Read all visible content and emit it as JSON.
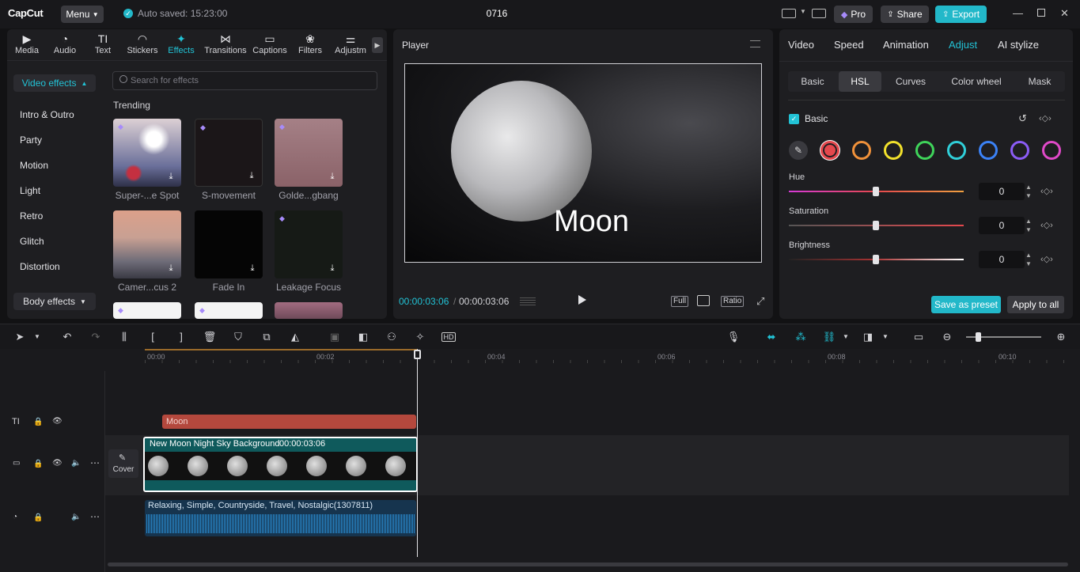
{
  "app": {
    "logo": "CapCut",
    "menu_label": "Menu",
    "autosave": "Auto saved: 15:23:00",
    "project_title": "0716"
  },
  "topbar": {
    "pro_label": "Pro",
    "share_label": "Share",
    "export_label": "Export",
    "accent": "#22c3d6"
  },
  "left_tabs": [
    {
      "label": "Media",
      "icon": "media-icon"
    },
    {
      "label": "Audio",
      "icon": "audio-icon"
    },
    {
      "label": "Text",
      "icon": "text-icon"
    },
    {
      "label": "Stickers",
      "icon": "stickers-icon"
    },
    {
      "label": "Effects",
      "icon": "effects-icon",
      "active": true
    },
    {
      "label": "Transitions",
      "icon": "transitions-icon"
    },
    {
      "label": "Captions",
      "icon": "captions-icon"
    },
    {
      "label": "Filters",
      "icon": "filters-icon"
    },
    {
      "label": "Adjustm",
      "icon": "adjustment-icon"
    }
  ],
  "effects": {
    "video_effects_label": "Video effects",
    "body_effects_label": "Body effects",
    "categories": [
      "Intro & Outro",
      "Party",
      "Motion",
      "Light",
      "Retro",
      "Glitch",
      "Distortion"
    ],
    "search_placeholder": "Search for effects",
    "section_title": "Trending",
    "items": [
      "Super-...e Spot",
      "S-movement",
      "Golde...gbang",
      "Camer...cus 2",
      "Fade In",
      "Leakage Focus"
    ]
  },
  "player": {
    "title": "Player",
    "overlay_text": "Moon",
    "current_time": "00:00:03:06",
    "total_time": "00:00:03:06",
    "full_label": "Full",
    "ratio_label": "Ratio"
  },
  "right_panel": {
    "tabs": [
      "Video",
      "Speed",
      "Animation",
      "Adjust",
      "AI stylize"
    ],
    "active_tab": "Adjust",
    "subtabs": [
      "Basic",
      "HSL",
      "Curves",
      "Color wheel",
      "Mask"
    ],
    "active_subtab": "HSL",
    "basic_label": "Basic",
    "hsl_colors": [
      "#e5484d",
      "#f0913a",
      "#f2e12c",
      "#3fd45a",
      "#30cfd9",
      "#3b82f6",
      "#8b5cf6",
      "#e049c8"
    ],
    "sliders": [
      {
        "label": "Hue",
        "value": "0"
      },
      {
        "label": "Saturation",
        "value": "0"
      },
      {
        "label": "Brightness",
        "value": "0"
      }
    ],
    "save_preset_label": "Save as preset",
    "apply_all_label": "Apply to all"
  },
  "timeline": {
    "ticks": [
      "00:00",
      "00:02",
      "00:04",
      "00:06",
      "00:08",
      "00:10"
    ],
    "text_clip": "Moon",
    "video_clip_title": "New Moon Night Sky Background",
    "video_clip_duration": "00:00:03:06",
    "cover_label": "Cover",
    "audio_clip_title": "Relaxing, Simple, Countryside, Travel, Nostalgic(1307811)"
  }
}
